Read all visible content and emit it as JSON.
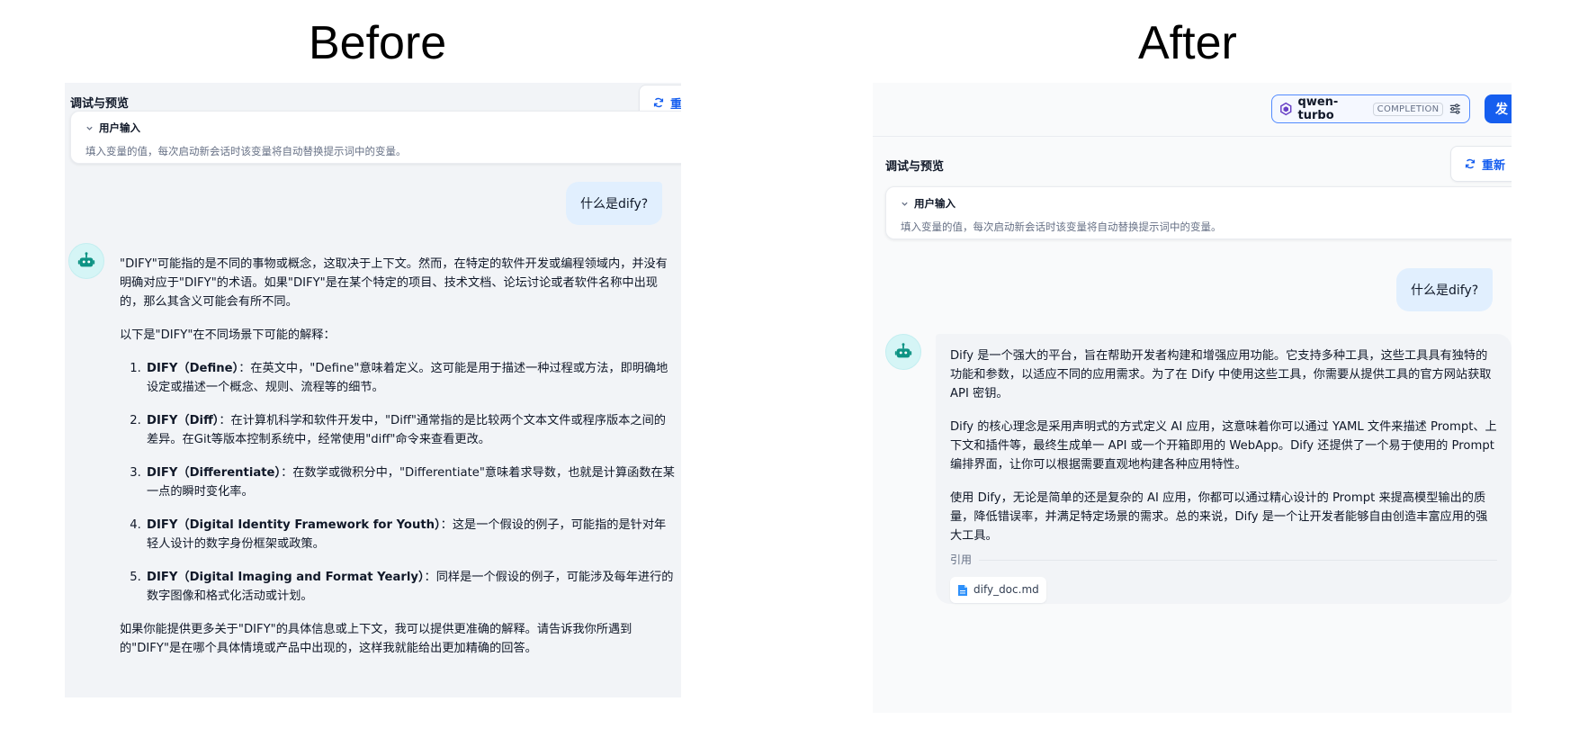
{
  "titles": {
    "before": "Before",
    "after": "After"
  },
  "before": {
    "panel_title": "调试与预览",
    "reset_label": "重",
    "user_input": {
      "label": "用户输入",
      "desc": "填入变量的值，每次启动新会话时该变量将自动替换提示词中的变量。"
    },
    "question": "什么是dify?",
    "answer": {
      "intro": "\"DIFY\"可能指的是不同的事物或概念，这取决于上下文。然而，在特定的软件开发或编程领域内，并没有明确对应于\"DIFY\"的术语。如果\"DIFY\"是在某个特定的项目、技术文档、论坛讨论或者软件名称中出现的，那么其含义可能会有所不同。",
      "lead": "以下是\"DIFY\"在不同场景下可能的解释：",
      "items": [
        {
          "term": "DIFY（Define）",
          "text": "：在英文中，\"Define\"意味着定义。这可能是用于描述一种过程或方法，即明确地设定或描述一个概念、规则、流程等的细节。"
        },
        {
          "term": "DIFY（Diff）",
          "text": "：在计算机科学和软件开发中，\"Diff\"通常指的是比较两个文本文件或程序版本之间的差异。在Git等版本控制系统中，经常使用\"diff\"命令来查看更改。"
        },
        {
          "term": "DIFY（Differentiate）",
          "text": "：在数学或微积分中，\"Differentiate\"意味着求导数，也就是计算函数在某一点的瞬时变化率。"
        },
        {
          "term": "DIFY（Digital Identity Framework for Youth）",
          "text": "：这是一个假设的例子，可能指的是针对年轻人设计的数字身份框架或政策。"
        },
        {
          "term": "DIFY（Digital Imaging and Format Yearly）",
          "text": "：同样是一个假设的例子，可能涉及每年进行的数字图像和格式化活动或计划。"
        }
      ],
      "outro": "如果你能提供更多关于\"DIFY\"的具体信息或上下文，我可以提供更准确的解释。请告诉我你所遇到的\"DIFY\"是在哪个具体情境或产品中出现的，这样我就能给出更加精确的回答。"
    }
  },
  "after": {
    "model": {
      "name": "qwen-turbo",
      "tag": "COMPLETION"
    },
    "publish_label": "发",
    "panel_title": "调试与预览",
    "reset_label": "重新",
    "user_input": {
      "label": "用户输入",
      "desc": "填入变量的值，每次启动新会话时该变量将自动替换提示词中的变量。"
    },
    "question": "什么是dify?",
    "answer": {
      "p1": "Dify 是一个强大的平台，旨在帮助开发者构建和增强应用功能。它支持多种工具，这些工具具有独特的功能和参数，以适应不同的应用需求。为了在 Dify 中使用这些工具，你需要从提供工具的官方网站获取 API 密钥。",
      "p2": "Dify 的核心理念是采用声明式的方式定义 AI 应用，这意味着你可以通过 YAML 文件来描述 Prompt、上下文和插件等，最终生成单一 API 或一个开箱即用的 WebApp。Dify 还提供了一个易于使用的 Prompt 编排界面，让你可以根据需要直观地构建各种应用特性。",
      "p3": "使用 Dify，无论是简单的还是复杂的 AI 应用，你都可以通过精心设计的 Prompt 来提高模型输出的质量，降低错误率，并满足特定场景的需求。总的来说，Dify 是一个让开发者能够自由创造丰富应用的强大工具。",
      "citation_label": "引用",
      "citation_file": "dify_doc.md"
    }
  }
}
